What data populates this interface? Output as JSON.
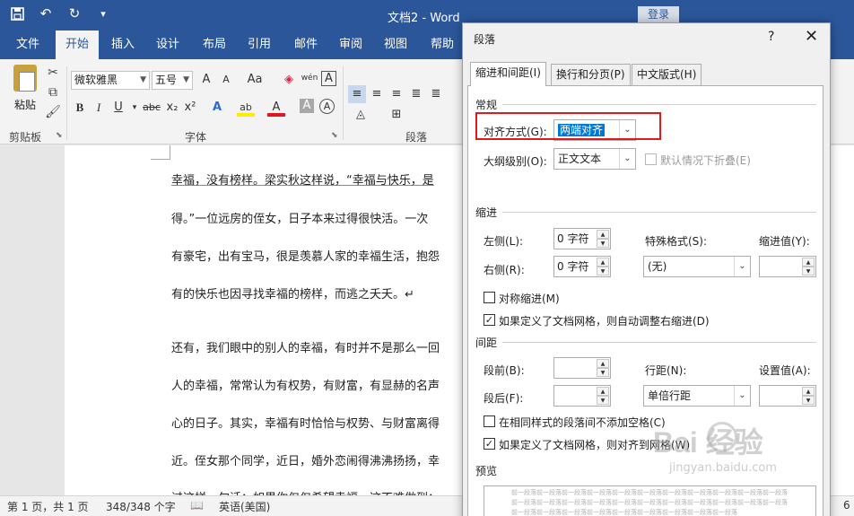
{
  "window": {
    "title": "文档2  -  Word",
    "login": "登录"
  },
  "qat_icons": [
    "save-icon",
    "undo-icon",
    "redo-icon",
    "customize-icon"
  ],
  "tabs": [
    "文件",
    "开始",
    "插入",
    "设计",
    "布局",
    "引用",
    "邮件",
    "审阅",
    "视图",
    "帮助"
  ],
  "ribbon": {
    "paste_label": "粘贴",
    "clipboard_label": "剪贴板",
    "font_group_label": "字体",
    "paragraph_group_label": "段落",
    "font_name": "微软雅黑",
    "font_size": "五号",
    "grow_font": "A",
    "shrink_font": "A",
    "change_case": "Aa",
    "phonetic": "wén",
    "char_border": "A",
    "bold": "B",
    "italic": "I",
    "underline": "U",
    "strikethrough": "abc",
    "subscript": "x₂",
    "superscript": "x²",
    "text_effects": "A",
    "highlight": "ab",
    "font_color": "A",
    "char_shading": "A",
    "enclose_char": "A"
  },
  "document": {
    "lines": [
      "幸福，没有榜样。梁实秋这样说，“幸福与快乐，是",
      "得。”一位远房的侄女，日子本来过得很快活。一次",
      "有豪宅，出有宝马，很是羡慕人家的幸福生活，抱怨",
      "有的快乐也因寻找幸福的榜样，而逃之夭夭。↵",
      "还有，我们眼中的别人的幸福，有时并不是那么一回",
      "人的幸福，常常认为有权势，有财富，有显赫的名声",
      "心的日子。其实，幸福有时恰恰与权势、与财富离得",
      "近。侄女那个同学，近日，婚外恋闹得沸沸扬扬，幸",
      "过这样一句话：如果你仅仅希望幸福，这不难做到；"
    ]
  },
  "status": {
    "page": "第 1 页，共 1 页",
    "words": "348/348 个字",
    "language": "英语(美国)",
    "zoom_hint": "6"
  },
  "dialog": {
    "title": "段落",
    "help": "?",
    "close": "✕",
    "tabs": [
      "缩进和间距(I)",
      "换行和分页(P)",
      "中文版式(H)"
    ],
    "general": {
      "heading": "常规",
      "alignment_label": "对齐方式(G):",
      "alignment_value": "两端对齐",
      "outline_label": "大纲级别(O):",
      "outline_value": "正文文本",
      "collapse_label": "默认情况下折叠(E)"
    },
    "indent": {
      "heading": "缩进",
      "left_label": "左侧(L):",
      "left_value": "0 字符",
      "right_label": "右侧(R):",
      "right_value": "0 字符",
      "special_label": "特殊格式(S):",
      "special_value": "(无)",
      "by_label": "缩进值(Y):",
      "by_value": "",
      "mirror_label": "对称缩进(M)",
      "auto_adjust_label": "如果定义了文档网格，则自动调整右缩进(D)"
    },
    "spacing": {
      "heading": "间距",
      "before_label": "段前(B):",
      "before_value": "",
      "after_label": "段后(F):",
      "after_value": "",
      "line_label": "行距(N):",
      "line_value": "单倍行距",
      "at_label": "设置值(A):",
      "at_value": "",
      "no_space_label": "在相同样式的段落间不添加空格(C)",
      "snap_grid_label": "如果定义了文档网格，则对齐到网格(W)"
    },
    "preview": {
      "heading": "预览",
      "lines": [
        "前一段落前一段落前一段落前一段落前一段落前一段落前一段落前一段落前一段落前一段落前一段落",
        "前一段落前一段落前一段落前一段落前一段落前一段落前一段落前一段落前一段落前一段落前一段落",
        "前一段落前一段落前一段落前一段落前一段落前一段落前一段落前一段落前一段落"
      ]
    }
  },
  "watermark": {
    "brand": "Bai  经验",
    "url": "jingyan.baidu.com"
  },
  "colors": {
    "word_blue": "#2b579a",
    "highlight_red": "#e0191f",
    "selection_blue": "#0078d7"
  }
}
